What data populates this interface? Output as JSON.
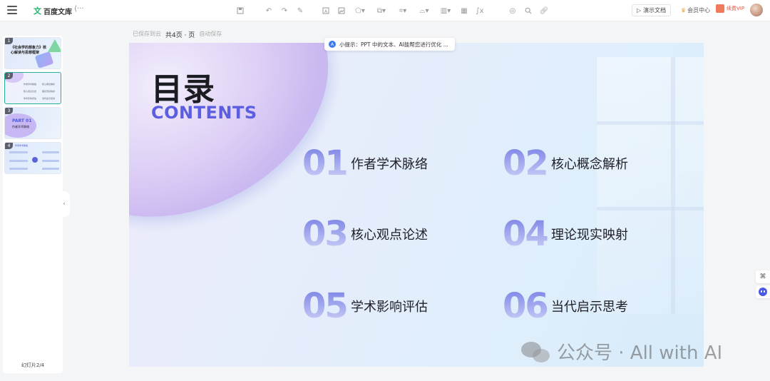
{
  "app": {
    "brand_logo": "文",
    "brand_name": "百度文库",
    "back_glyph": "⟨···"
  },
  "toolbar": {
    "icons": [
      "save-icon",
      "undo-icon",
      "redo-icon",
      "format-paint-icon",
      "text-box-icon",
      "image-icon",
      "shape-icon",
      "copy-style-icon",
      "crop-icon",
      "special-shape-icon",
      "chart-icon",
      "table-icon",
      "formula-icon",
      "target-icon",
      "search-icon",
      "link-icon"
    ]
  },
  "header_right": {
    "present_label": "演示文档",
    "member_label": "会员中心",
    "vip_label": "续费VIP"
  },
  "slide_header": {
    "left": "已保存到云",
    "middle": "共4页 · 页",
    "right": "自动保存"
  },
  "tip": {
    "icon": "A",
    "text": "小提示：PPT 中的文本、AI能帮您进行优化 ..."
  },
  "sidebar": {
    "thumbnails": [
      {
        "num": "1",
        "title": "《社会学的想象力》核心解读与思想框架",
        "sub": "汇报人：XX"
      },
      {
        "num": "2",
        "rows": [
          "作者学术脉络",
          "核心概念解析",
          "核心观点论述",
          "理论现实映射",
          "学术影响评估",
          "当代启示思考"
        ]
      },
      {
        "num": "3",
        "part": "PART 01",
        "sub": "作者学术脉络"
      },
      {
        "num": "4",
        "title": "作者学术脉络"
      }
    ],
    "slide_count": "幻灯片2/4"
  },
  "slide": {
    "title_cn": "目录",
    "title_en": "CONTENTS",
    "items": [
      {
        "num": "01",
        "text": "作者学术脉络"
      },
      {
        "num": "02",
        "text": "核心概念解析"
      },
      {
        "num": "03",
        "text": "核心观点论述"
      },
      {
        "num": "04",
        "text": "理论现实映射"
      },
      {
        "num": "05",
        "text": "学术影响评估"
      },
      {
        "num": "06",
        "text": "当代启示思考"
      }
    ]
  },
  "right_tools": {
    "tool1": "⌘"
  },
  "watermark": {
    "text": "公众号 · All with AI"
  }
}
